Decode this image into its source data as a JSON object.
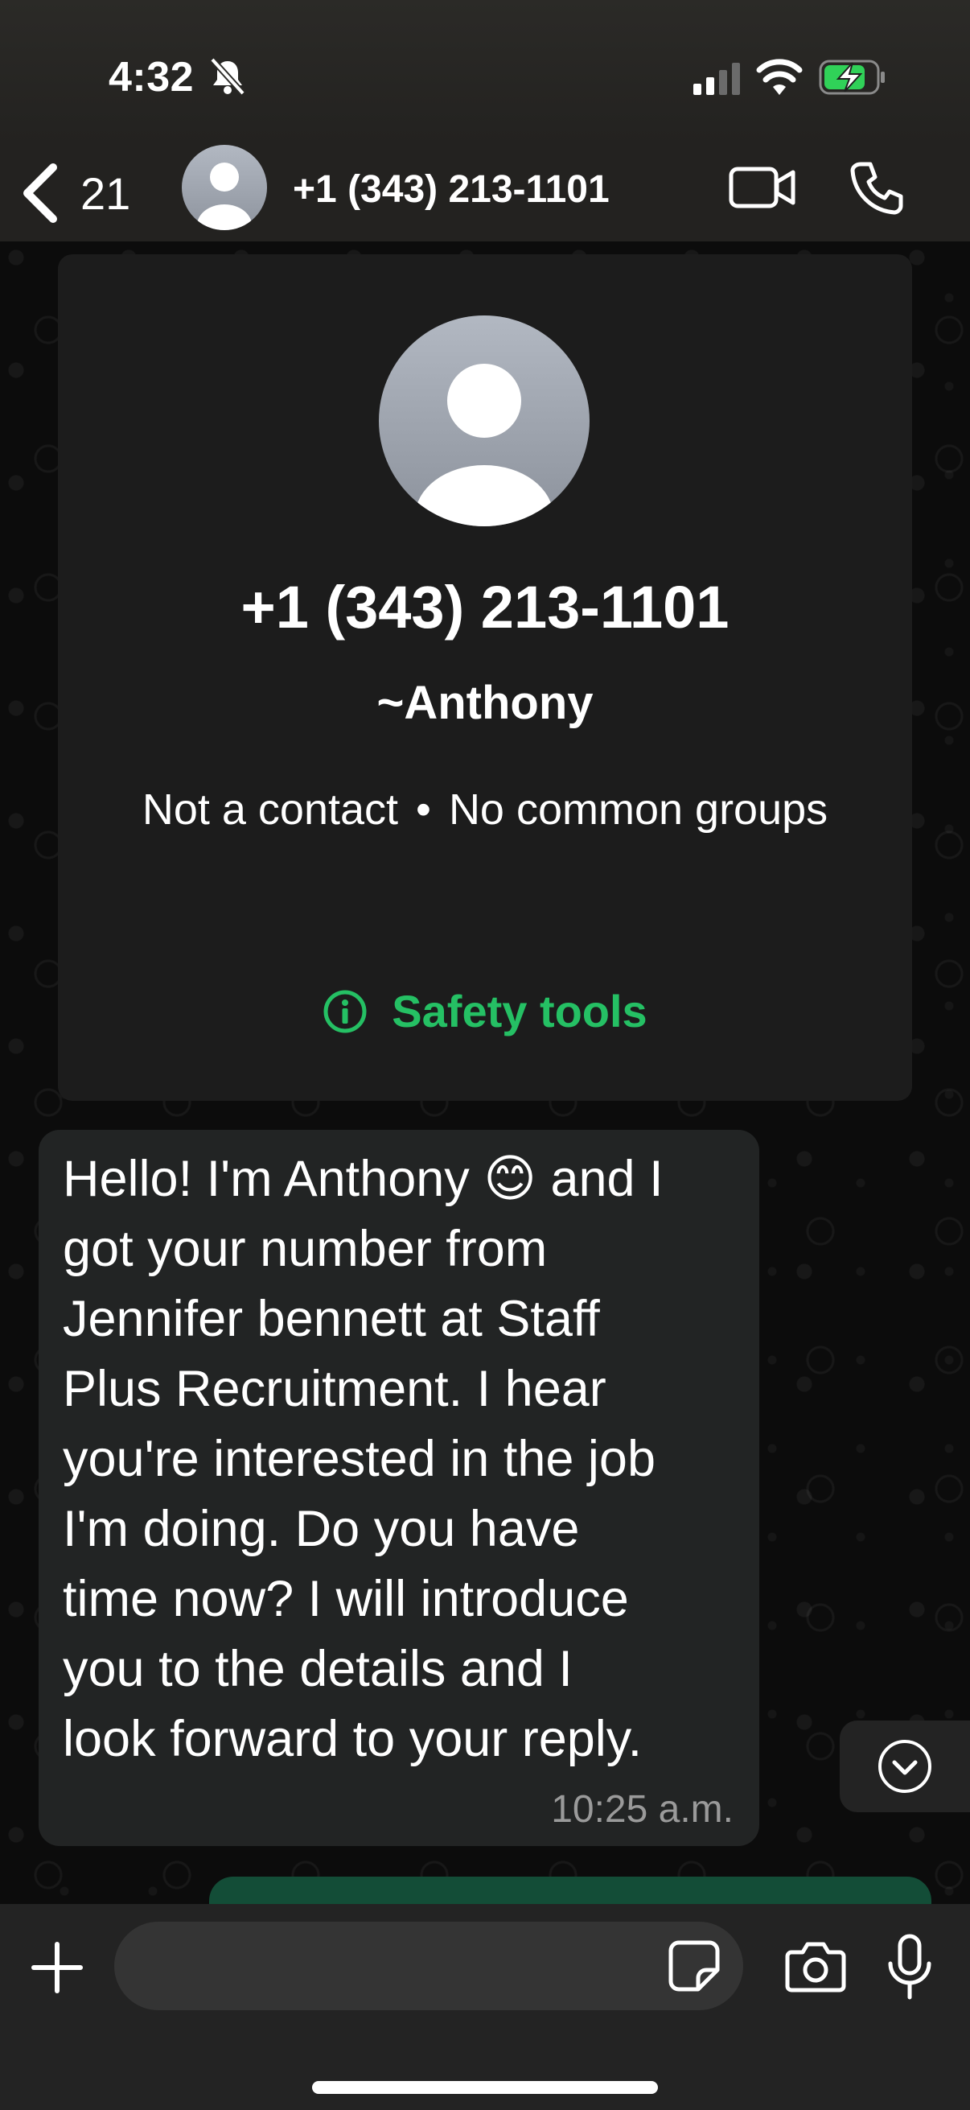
{
  "status_bar": {
    "time": "4:32",
    "icons": [
      "bell-slash-icon",
      "cellular-signal-icon",
      "wifi-icon",
      "battery-charging-icon"
    ]
  },
  "header": {
    "back_count": "21",
    "title": "+1 (343) 213-1101",
    "icons": [
      "back-chevron-icon",
      "avatar-placeholder-icon",
      "video-camera-icon",
      "phone-icon"
    ]
  },
  "info_card": {
    "phone": "+1 (343) 213-1101",
    "name": "~Anthony",
    "status_left": "Not a contact",
    "separator": "•",
    "status_right": "No common groups",
    "safety_tools": "Safety tools",
    "accent_color": "#25c064"
  },
  "message": {
    "text": "Hello! I'm Anthony 😊 and I\ngot your number from\nJennifer bennett at Staff\nPlus Recruitment. I hear\nyou're interested in the job\nI'm doing. Do you have\ntime now? I will introduce\nyou to the details and I\nlook forward to your reply.",
    "time": "10:25 a.m."
  },
  "composer": {
    "placeholder": "",
    "value": "",
    "icons": [
      "plus-icon",
      "sticker-icon",
      "camera-icon",
      "microphone-icon"
    ]
  },
  "colors": {
    "header_bg": "#232220",
    "bubble_bg": "#222424",
    "outgoing_bubble": "#134d37"
  }
}
